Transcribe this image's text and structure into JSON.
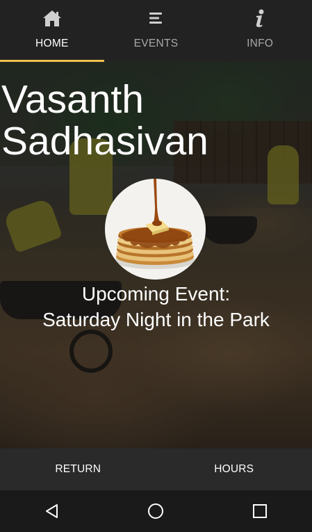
{
  "tabs": [
    {
      "label": "HOME",
      "icon": "home-icon",
      "active": true
    },
    {
      "label": "EVENTS",
      "icon": "list-icon",
      "active": false
    },
    {
      "label": "INFO",
      "icon": "info-icon",
      "active": false
    }
  ],
  "hero": {
    "title": "Vasanth Sadhasivan",
    "event_label": "Upcoming Event:",
    "event_name": "Saturday Night in the Park",
    "event_image": "pancakes-syrup-image"
  },
  "actions": {
    "return_label": "RETURN",
    "hours_label": "HOURS"
  },
  "system_nav": {
    "back": "back-triangle-icon",
    "home": "home-circle-icon",
    "recents": "recents-square-icon"
  },
  "colors": {
    "tab_bar_bg": "#222222",
    "tab_indicator": "#f2c14e",
    "action_bar_bg": "#2a2a2a",
    "nav_bar_bg": "#1a1a1a",
    "inactive_tab_text": "#a9a9a9"
  }
}
